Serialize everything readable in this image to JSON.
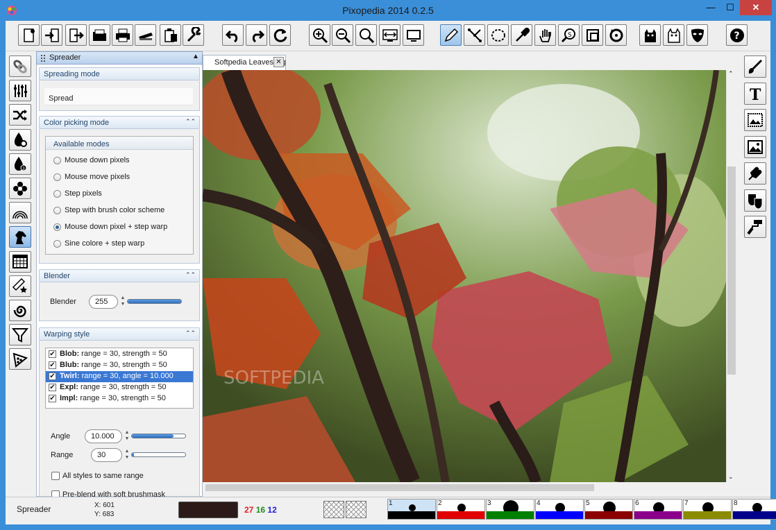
{
  "window": {
    "title": "Pixopedia 2014 0.2.5",
    "minimize": "—",
    "maximize": "☐",
    "close": "✕"
  },
  "toolbar": {
    "items": [
      "new-image",
      "import",
      "export",
      "open",
      "print",
      "scan",
      "clipboard-paste",
      "settings",
      "undo",
      "redo",
      "refresh",
      "zoom-in",
      "zoom-out",
      "zoom-fit",
      "fit-width",
      "fullscreen",
      "pen-tool",
      "path-tool",
      "ellipse-select",
      "color-picker",
      "pan-hand",
      "zoom-search",
      "crop",
      "rotate",
      "cat-black",
      "cat-white",
      "mask",
      "help"
    ],
    "selected": "pen-tool"
  },
  "left_tools": [
    "links",
    "sliders",
    "shuffle",
    "drop-gear",
    "drop-3",
    "flower",
    "rainbow",
    "horse",
    "grid",
    "pen-star",
    "spiral",
    "filter",
    "pizza"
  ],
  "left_selected": "horse",
  "right_tools": [
    "paint-brush",
    "text",
    "image-frame",
    "landscape",
    "plug",
    "theater-masks",
    "paint-roller"
  ],
  "panel": {
    "title": "Spreader",
    "spreading_mode": {
      "title": "Spreading mode",
      "value": "Spread"
    },
    "color_picking": {
      "title": "Color picking mode",
      "group_title": "Available modes",
      "options": [
        "Mouse down pixels",
        "Mouse move pixels",
        "Step pixels",
        "Step with brush color scheme",
        "Mouse down pixel + step warp",
        "Sine colore + step warp"
      ],
      "selected_index": 4
    },
    "blender": {
      "title": "Blender",
      "label": "Blender",
      "value": "255",
      "level": 1.0
    },
    "warping": {
      "title": "Warping style",
      "styles": [
        {
          "name": "Blob:",
          "desc": " range = 30, strength = 50",
          "checked": true
        },
        {
          "name": "Blub:",
          "desc": " range = 30, strength = 50",
          "checked": true
        },
        {
          "name": "Twirl:",
          "desc": " range = 30, angle = 10.000",
          "checked": true
        },
        {
          "name": "Expl:",
          "desc": " range = 30, strength = 50",
          "checked": true
        },
        {
          "name": "Impl:",
          "desc": " range = 30, strength = 50",
          "checked": true
        }
      ],
      "selected_index": 2,
      "angle_label": "Angle",
      "angle_value": "10.000",
      "angle_level": 0.78,
      "range_label": "Range",
      "range_value": "30",
      "range_level": 0.03,
      "same_range_label": "All styles to same range",
      "preblend_label": "Pre-blend with soft brushmask"
    }
  },
  "document": {
    "tab_label": "Softpedia Leaves.jpg",
    "watermark": "SOFTPEDIA"
  },
  "status": {
    "tool": "Spreader",
    "x": "X: 601",
    "y": "Y: 683",
    "color": "#2b1a17",
    "r": "27",
    "g": "16",
    "b": "12",
    "brushes": [
      {
        "num": "1",
        "color": "#000000"
      },
      {
        "num": "2",
        "color": "#e00000"
      },
      {
        "num": "3",
        "color": "#008000"
      },
      {
        "num": "4",
        "color": "#0000ff"
      },
      {
        "num": "5",
        "color": "#8b0000"
      },
      {
        "num": "6",
        "color": "#8b008b"
      },
      {
        "num": "7",
        "color": "#8b8b00"
      },
      {
        "num": "8",
        "color": "#00008b"
      }
    ]
  }
}
